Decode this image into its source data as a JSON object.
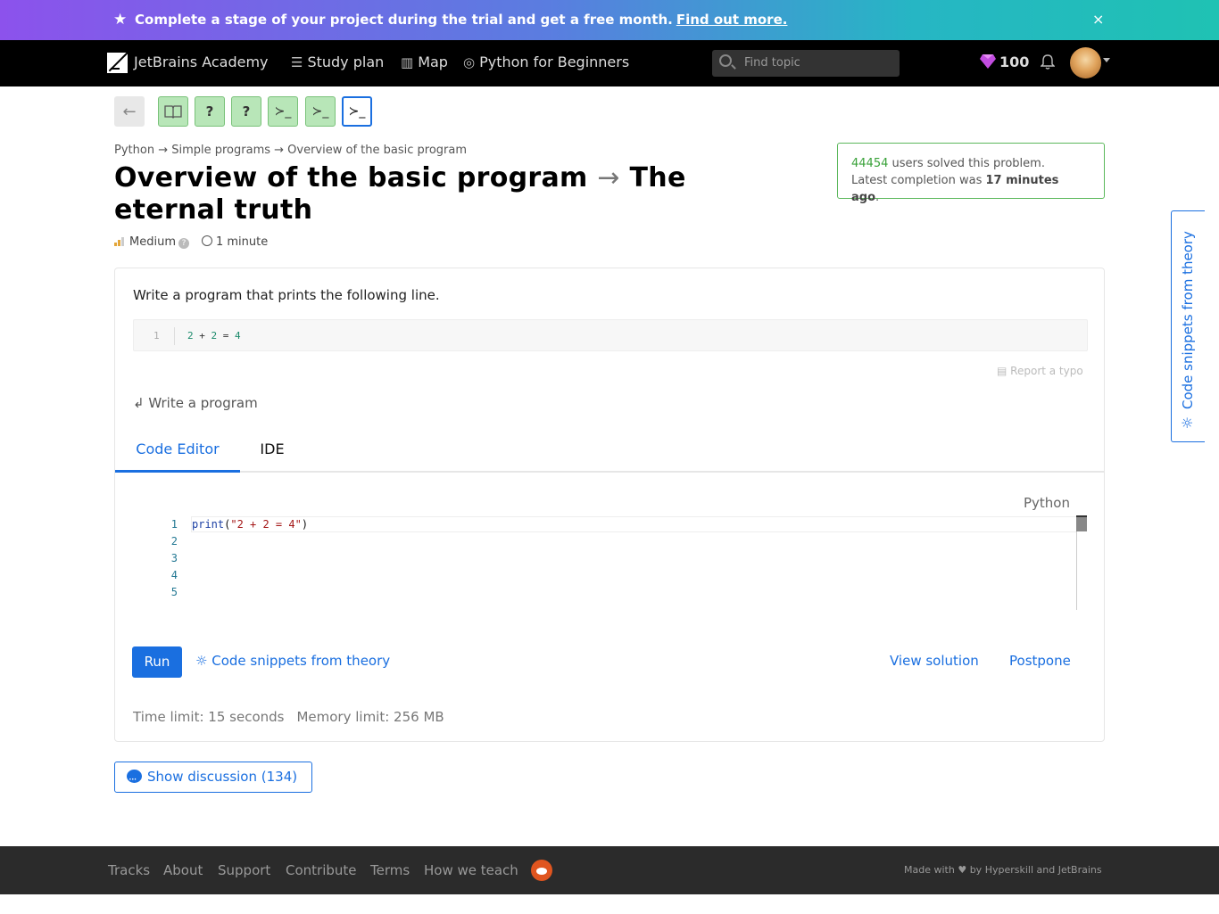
{
  "banner": {
    "message": "Complete a stage of your project during the trial and get a free month.",
    "link": "Find out more.",
    "close": "×"
  },
  "header": {
    "brand": "JetBrains Academy",
    "nav": [
      {
        "label": "Study plan",
        "icon": "list-icon"
      },
      {
        "label": "Map",
        "icon": "map-icon"
      },
      {
        "label": "Python for Beginners",
        "icon": "target-icon"
      }
    ],
    "search_placeholder": "Find topic",
    "gems": "100"
  },
  "steps": [
    {
      "type": "back",
      "symbol": "←"
    },
    {
      "type": "theory",
      "symbol": "📖",
      "state": "done"
    },
    {
      "type": "quiz",
      "symbol": "?",
      "state": "done"
    },
    {
      "type": "quiz",
      "symbol": "?",
      "state": "done"
    },
    {
      "type": "code",
      "symbol": "≻_",
      "state": "done"
    },
    {
      "type": "code",
      "symbol": "≻_",
      "state": "done"
    },
    {
      "type": "code",
      "symbol": "≻_",
      "state": "current"
    }
  ],
  "breadcrumb": "Python → Simple programs → Overview of the basic program",
  "title": {
    "topic": "Overview of the basic program",
    "arrow": "→",
    "problem": "The eternal truth"
  },
  "meta": {
    "difficulty": "Medium",
    "time": "1 minute"
  },
  "solved": {
    "count": "44454",
    "count_suffix": "users solved this problem.",
    "latest_prefix": "Latest completion was",
    "latest_value": "17 minutes ago",
    "latest_suffix": "."
  },
  "side_tab": "Code snippets from theory",
  "task": {
    "text": "Write a program that prints the following line.",
    "sample_line_no": "1",
    "sample_code": {
      "a": "2",
      "plus": "+",
      "b": "2",
      "eq": "=",
      "c": "4"
    },
    "report_typo": "Report a typo",
    "write_program": "Write a program"
  },
  "tabs": [
    "Code Editor",
    "IDE"
  ],
  "editor": {
    "language": "Python",
    "line_numbers": [
      "1",
      "2",
      "3",
      "4",
      "5"
    ],
    "code_fn": "print",
    "code_open": "(",
    "code_str": "\"2 + 2 = 4\"",
    "code_close": ")"
  },
  "actions": {
    "run": "Run",
    "snippets": "Code snippets from theory",
    "view_solution": "View solution",
    "postpone": "Postpone"
  },
  "limits": {
    "time": "Time limit: 15 seconds",
    "memory": "Memory limit: 256 MB"
  },
  "discussion": "Show discussion (134)",
  "footer": {
    "links": [
      "Tracks",
      "About",
      "Support",
      "Contribute",
      "Terms",
      "How we teach"
    ],
    "made_prefix": "Made with",
    "made_suffix": "by Hyperskill and JetBrains"
  },
  "colors": {
    "accent": "#1a6fe0",
    "success": "#5cb85c",
    "done_step": "#b8e6b8",
    "banner_start": "#8c52ec",
    "banner_end": "#1fc2b3"
  }
}
